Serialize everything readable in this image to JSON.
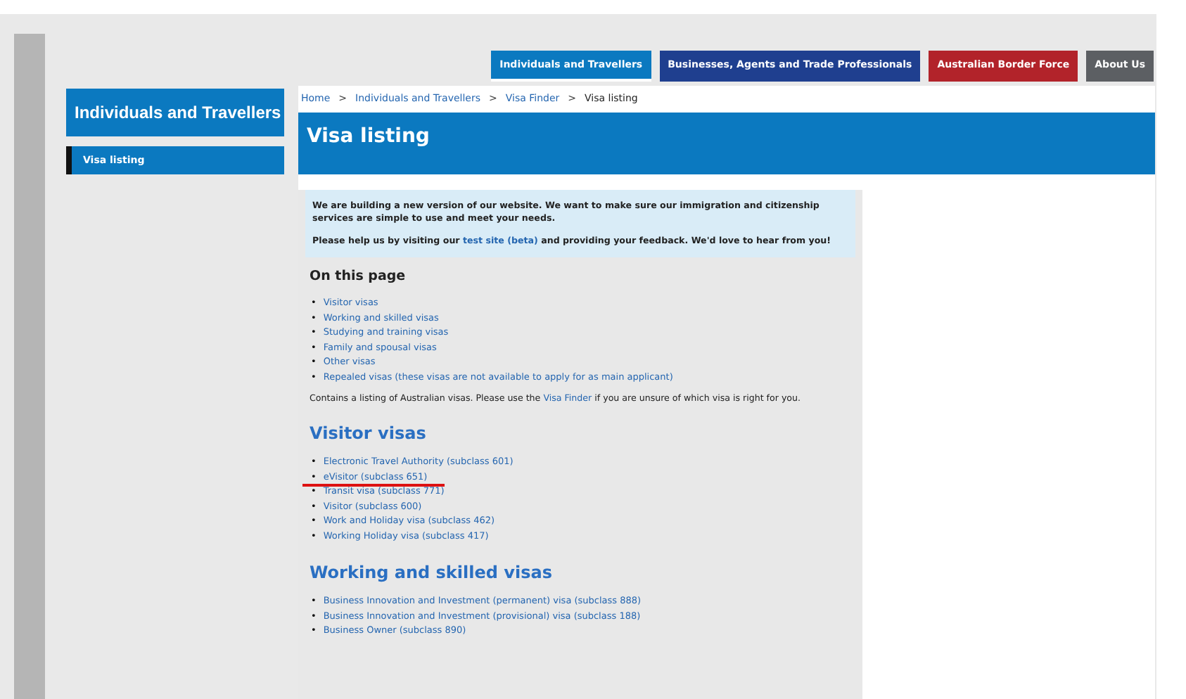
{
  "top_nav": [
    {
      "label": "Individuals and Travellers",
      "color": "#0b79c0",
      "selected": true
    },
    {
      "label": "Businesses, Agents and Trade Professionals",
      "color": "#1f3f8f",
      "selected": false
    },
    {
      "label": "Australian Border Force",
      "color": "#b2232a",
      "selected": false
    },
    {
      "label": "About Us",
      "color": "#5c5f63",
      "selected": false
    }
  ],
  "sidebar": {
    "title": "Individuals and Travellers",
    "items": [
      {
        "label": "Visa listing",
        "selected": true
      }
    ]
  },
  "breadcrumb": [
    {
      "label": "Home",
      "current": false
    },
    {
      "label": "Individuals and Travellers",
      "current": false
    },
    {
      "label": "Visa Finder",
      "current": false
    },
    {
      "label": "Visa listing",
      "current": true
    }
  ],
  "breadcrumb_separator": ">",
  "bullet": "•",
  "page_title": "Visa listing",
  "notice": {
    "paragraphs": [
      {
        "before": "We are building a new version of our website. We want to make sure our immigration and citizenship services are simple to use and meet your needs."
      },
      {
        "before": "Please help us by visiting our ",
        "link": "test site (beta)",
        "after": " and providing your feedback. We'd love to hear from you!"
      }
    ]
  },
  "on_this_page": {
    "heading": "On this page",
    "links": [
      "Visitor visas",
      "Working and skilled visas",
      "Studying and training visas",
      "Family and spousal visas",
      "Other visas",
      "Repealed visas (these visas are not available to apply for as main applicant)"
    ]
  },
  "intro": {
    "before": "Contains a listing of Australian visas. Please use the ",
    "link": "Visa Finder",
    "after": " if you are unsure of which visa is right for you."
  },
  "sections": [
    {
      "heading": "Visitor visas",
      "items": [
        {
          "label": "Electronic Travel Authority (subclass 601)",
          "underlined": false
        },
        {
          "label": "eVisitor (subclass 651)",
          "underlined": true
        },
        {
          "label": "Transit visa (subclass 771)",
          "underlined": false
        },
        {
          "label": "Visitor (subclass 600)",
          "underlined": false
        },
        {
          "label": "Work and Holiday visa (subclass 462)",
          "underlined": false
        },
        {
          "label": "Working Holiday visa (subclass 417)",
          "underlined": false
        }
      ]
    },
    {
      "heading": "Working and skilled visas",
      "items": [
        {
          "label": "Business Innovation and Investment (permanent) visa (subclass 888)",
          "underlined": false
        },
        {
          "label": "Business Innovation and Investment (provisional) visa (subclass 188)",
          "underlined": false
        },
        {
          "label": "Business Owner (subclass 890)",
          "underlined": false
        }
      ]
    }
  ]
}
